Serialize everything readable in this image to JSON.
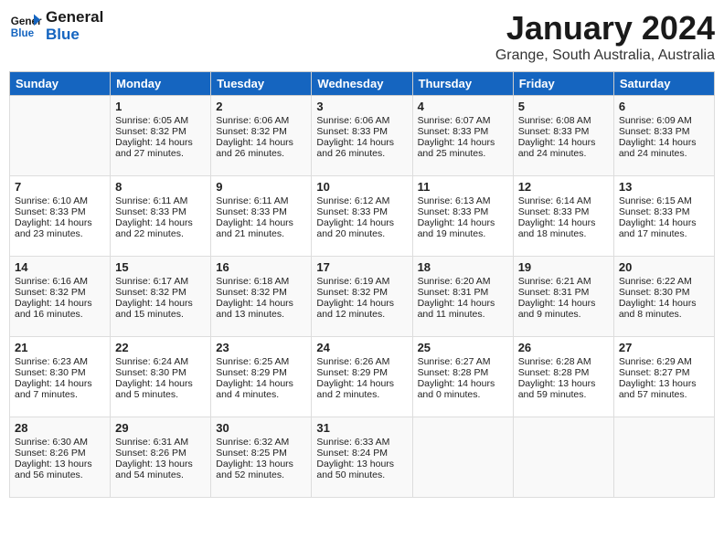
{
  "header": {
    "logo_line1": "General",
    "logo_line2": "Blue",
    "month_year": "January 2024",
    "location": "Grange, South Australia, Australia"
  },
  "days_of_week": [
    "Sunday",
    "Monday",
    "Tuesday",
    "Wednesday",
    "Thursday",
    "Friday",
    "Saturday"
  ],
  "weeks": [
    [
      {
        "day": "",
        "sunrise": "",
        "sunset": "",
        "daylight": ""
      },
      {
        "day": "1",
        "sunrise": "Sunrise: 6:05 AM",
        "sunset": "Sunset: 8:32 PM",
        "daylight": "Daylight: 14 hours and 27 minutes."
      },
      {
        "day": "2",
        "sunrise": "Sunrise: 6:06 AM",
        "sunset": "Sunset: 8:32 PM",
        "daylight": "Daylight: 14 hours and 26 minutes."
      },
      {
        "day": "3",
        "sunrise": "Sunrise: 6:06 AM",
        "sunset": "Sunset: 8:33 PM",
        "daylight": "Daylight: 14 hours and 26 minutes."
      },
      {
        "day": "4",
        "sunrise": "Sunrise: 6:07 AM",
        "sunset": "Sunset: 8:33 PM",
        "daylight": "Daylight: 14 hours and 25 minutes."
      },
      {
        "day": "5",
        "sunrise": "Sunrise: 6:08 AM",
        "sunset": "Sunset: 8:33 PM",
        "daylight": "Daylight: 14 hours and 24 minutes."
      },
      {
        "day": "6",
        "sunrise": "Sunrise: 6:09 AM",
        "sunset": "Sunset: 8:33 PM",
        "daylight": "Daylight: 14 hours and 24 minutes."
      }
    ],
    [
      {
        "day": "7",
        "sunrise": "Sunrise: 6:10 AM",
        "sunset": "Sunset: 8:33 PM",
        "daylight": "Daylight: 14 hours and 23 minutes."
      },
      {
        "day": "8",
        "sunrise": "Sunrise: 6:11 AM",
        "sunset": "Sunset: 8:33 PM",
        "daylight": "Daylight: 14 hours and 22 minutes."
      },
      {
        "day": "9",
        "sunrise": "Sunrise: 6:11 AM",
        "sunset": "Sunset: 8:33 PM",
        "daylight": "Daylight: 14 hours and 21 minutes."
      },
      {
        "day": "10",
        "sunrise": "Sunrise: 6:12 AM",
        "sunset": "Sunset: 8:33 PM",
        "daylight": "Daylight: 14 hours and 20 minutes."
      },
      {
        "day": "11",
        "sunrise": "Sunrise: 6:13 AM",
        "sunset": "Sunset: 8:33 PM",
        "daylight": "Daylight: 14 hours and 19 minutes."
      },
      {
        "day": "12",
        "sunrise": "Sunrise: 6:14 AM",
        "sunset": "Sunset: 8:33 PM",
        "daylight": "Daylight: 14 hours and 18 minutes."
      },
      {
        "day": "13",
        "sunrise": "Sunrise: 6:15 AM",
        "sunset": "Sunset: 8:33 PM",
        "daylight": "Daylight: 14 hours and 17 minutes."
      }
    ],
    [
      {
        "day": "14",
        "sunrise": "Sunrise: 6:16 AM",
        "sunset": "Sunset: 8:32 PM",
        "daylight": "Daylight: 14 hours and 16 minutes."
      },
      {
        "day": "15",
        "sunrise": "Sunrise: 6:17 AM",
        "sunset": "Sunset: 8:32 PM",
        "daylight": "Daylight: 14 hours and 15 minutes."
      },
      {
        "day": "16",
        "sunrise": "Sunrise: 6:18 AM",
        "sunset": "Sunset: 8:32 PM",
        "daylight": "Daylight: 14 hours and 13 minutes."
      },
      {
        "day": "17",
        "sunrise": "Sunrise: 6:19 AM",
        "sunset": "Sunset: 8:32 PM",
        "daylight": "Daylight: 14 hours and 12 minutes."
      },
      {
        "day": "18",
        "sunrise": "Sunrise: 6:20 AM",
        "sunset": "Sunset: 8:31 PM",
        "daylight": "Daylight: 14 hours and 11 minutes."
      },
      {
        "day": "19",
        "sunrise": "Sunrise: 6:21 AM",
        "sunset": "Sunset: 8:31 PM",
        "daylight": "Daylight: 14 hours and 9 minutes."
      },
      {
        "day": "20",
        "sunrise": "Sunrise: 6:22 AM",
        "sunset": "Sunset: 8:30 PM",
        "daylight": "Daylight: 14 hours and 8 minutes."
      }
    ],
    [
      {
        "day": "21",
        "sunrise": "Sunrise: 6:23 AM",
        "sunset": "Sunset: 8:30 PM",
        "daylight": "Daylight: 14 hours and 7 minutes."
      },
      {
        "day": "22",
        "sunrise": "Sunrise: 6:24 AM",
        "sunset": "Sunset: 8:30 PM",
        "daylight": "Daylight: 14 hours and 5 minutes."
      },
      {
        "day": "23",
        "sunrise": "Sunrise: 6:25 AM",
        "sunset": "Sunset: 8:29 PM",
        "daylight": "Daylight: 14 hours and 4 minutes."
      },
      {
        "day": "24",
        "sunrise": "Sunrise: 6:26 AM",
        "sunset": "Sunset: 8:29 PM",
        "daylight": "Daylight: 14 hours and 2 minutes."
      },
      {
        "day": "25",
        "sunrise": "Sunrise: 6:27 AM",
        "sunset": "Sunset: 8:28 PM",
        "daylight": "Daylight: 14 hours and 0 minutes."
      },
      {
        "day": "26",
        "sunrise": "Sunrise: 6:28 AM",
        "sunset": "Sunset: 8:28 PM",
        "daylight": "Daylight: 13 hours and 59 minutes."
      },
      {
        "day": "27",
        "sunrise": "Sunrise: 6:29 AM",
        "sunset": "Sunset: 8:27 PM",
        "daylight": "Daylight: 13 hours and 57 minutes."
      }
    ],
    [
      {
        "day": "28",
        "sunrise": "Sunrise: 6:30 AM",
        "sunset": "Sunset: 8:26 PM",
        "daylight": "Daylight: 13 hours and 56 minutes."
      },
      {
        "day": "29",
        "sunrise": "Sunrise: 6:31 AM",
        "sunset": "Sunset: 8:26 PM",
        "daylight": "Daylight: 13 hours and 54 minutes."
      },
      {
        "day": "30",
        "sunrise": "Sunrise: 6:32 AM",
        "sunset": "Sunset: 8:25 PM",
        "daylight": "Daylight: 13 hours and 52 minutes."
      },
      {
        "day": "31",
        "sunrise": "Sunrise: 6:33 AM",
        "sunset": "Sunset: 8:24 PM",
        "daylight": "Daylight: 13 hours and 50 minutes."
      },
      {
        "day": "",
        "sunrise": "",
        "sunset": "",
        "daylight": ""
      },
      {
        "day": "",
        "sunrise": "",
        "sunset": "",
        "daylight": ""
      },
      {
        "day": "",
        "sunrise": "",
        "sunset": "",
        "daylight": ""
      }
    ]
  ]
}
